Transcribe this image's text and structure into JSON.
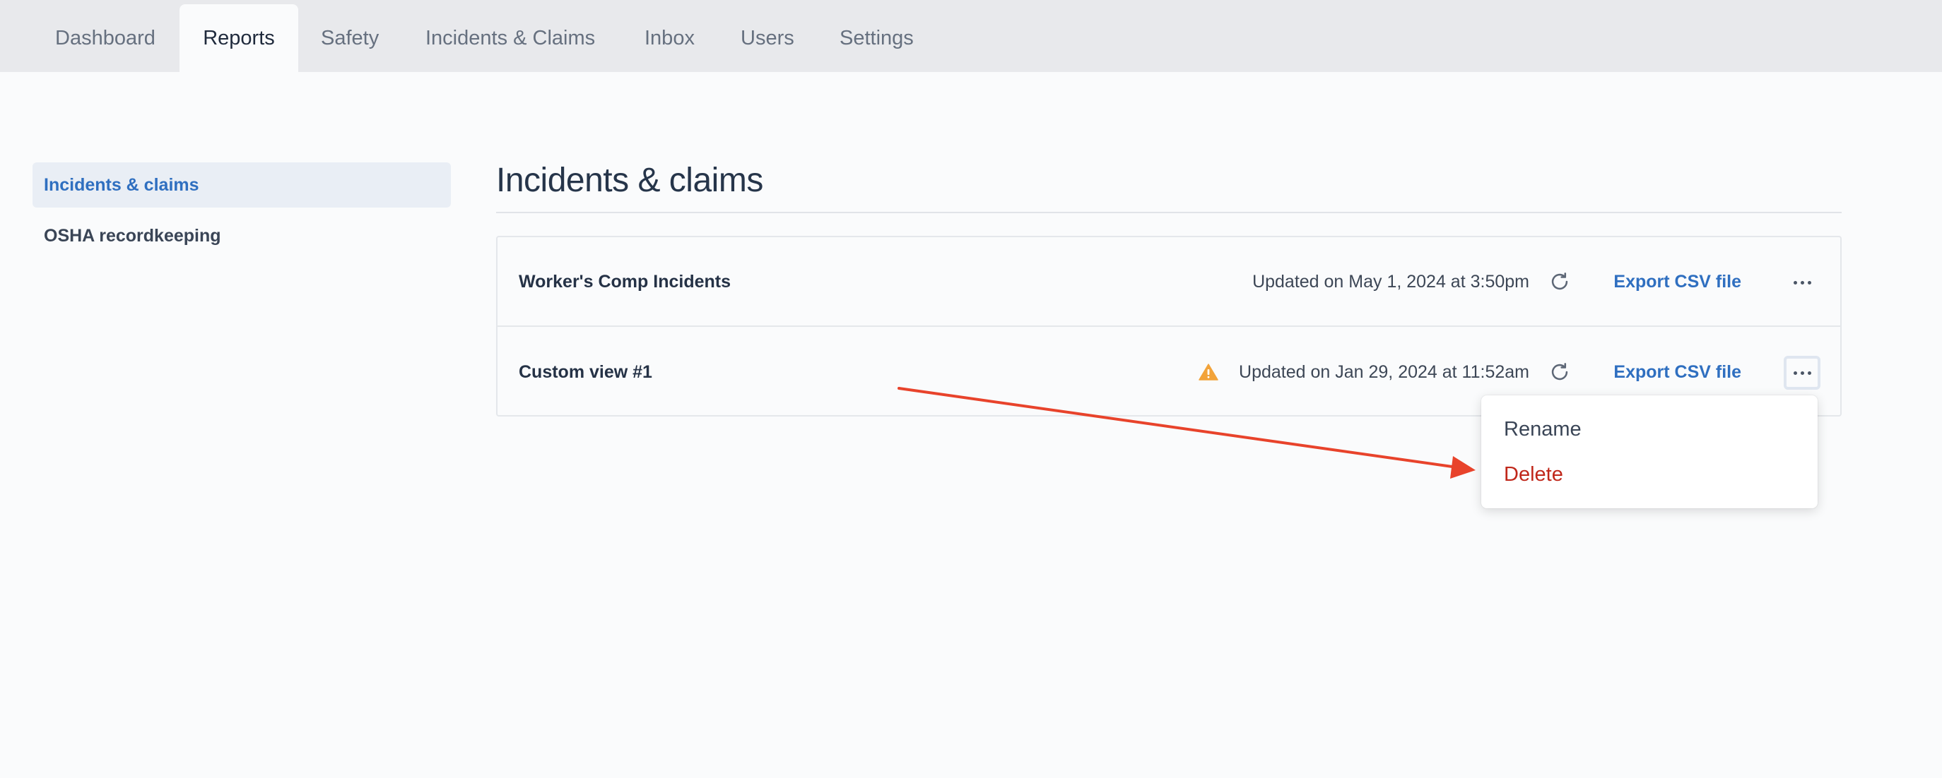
{
  "tabs": [
    {
      "label": "Dashboard",
      "active": false
    },
    {
      "label": "Reports",
      "active": true
    },
    {
      "label": "Safety",
      "active": false
    },
    {
      "label": "Incidents & Claims",
      "active": false
    },
    {
      "label": "Inbox",
      "active": false
    },
    {
      "label": "Users",
      "active": false
    },
    {
      "label": "Settings",
      "active": false
    }
  ],
  "sidebar": {
    "items": [
      {
        "label": "Incidents & claims",
        "active": true
      },
      {
        "label": "OSHA recordkeeping",
        "active": false
      }
    ]
  },
  "main": {
    "title": "Incidents & claims",
    "reports": [
      {
        "name": "Worker's Comp Incidents",
        "updated": "Updated on May 1, 2024 at 3:50pm",
        "warning": false,
        "export_label": "Export CSV file"
      },
      {
        "name": "Custom view #1",
        "updated": "Updated on Jan 29, 2024 at 11:52am",
        "warning": true,
        "export_label": "Export CSV file"
      }
    ]
  },
  "menu": {
    "rename_label": "Rename",
    "delete_label": "Delete"
  },
  "colors": {
    "accent": "#2f6fc0",
    "danger": "#c0271a",
    "warning": "#f2a33a",
    "annotation": "#e8432b"
  }
}
